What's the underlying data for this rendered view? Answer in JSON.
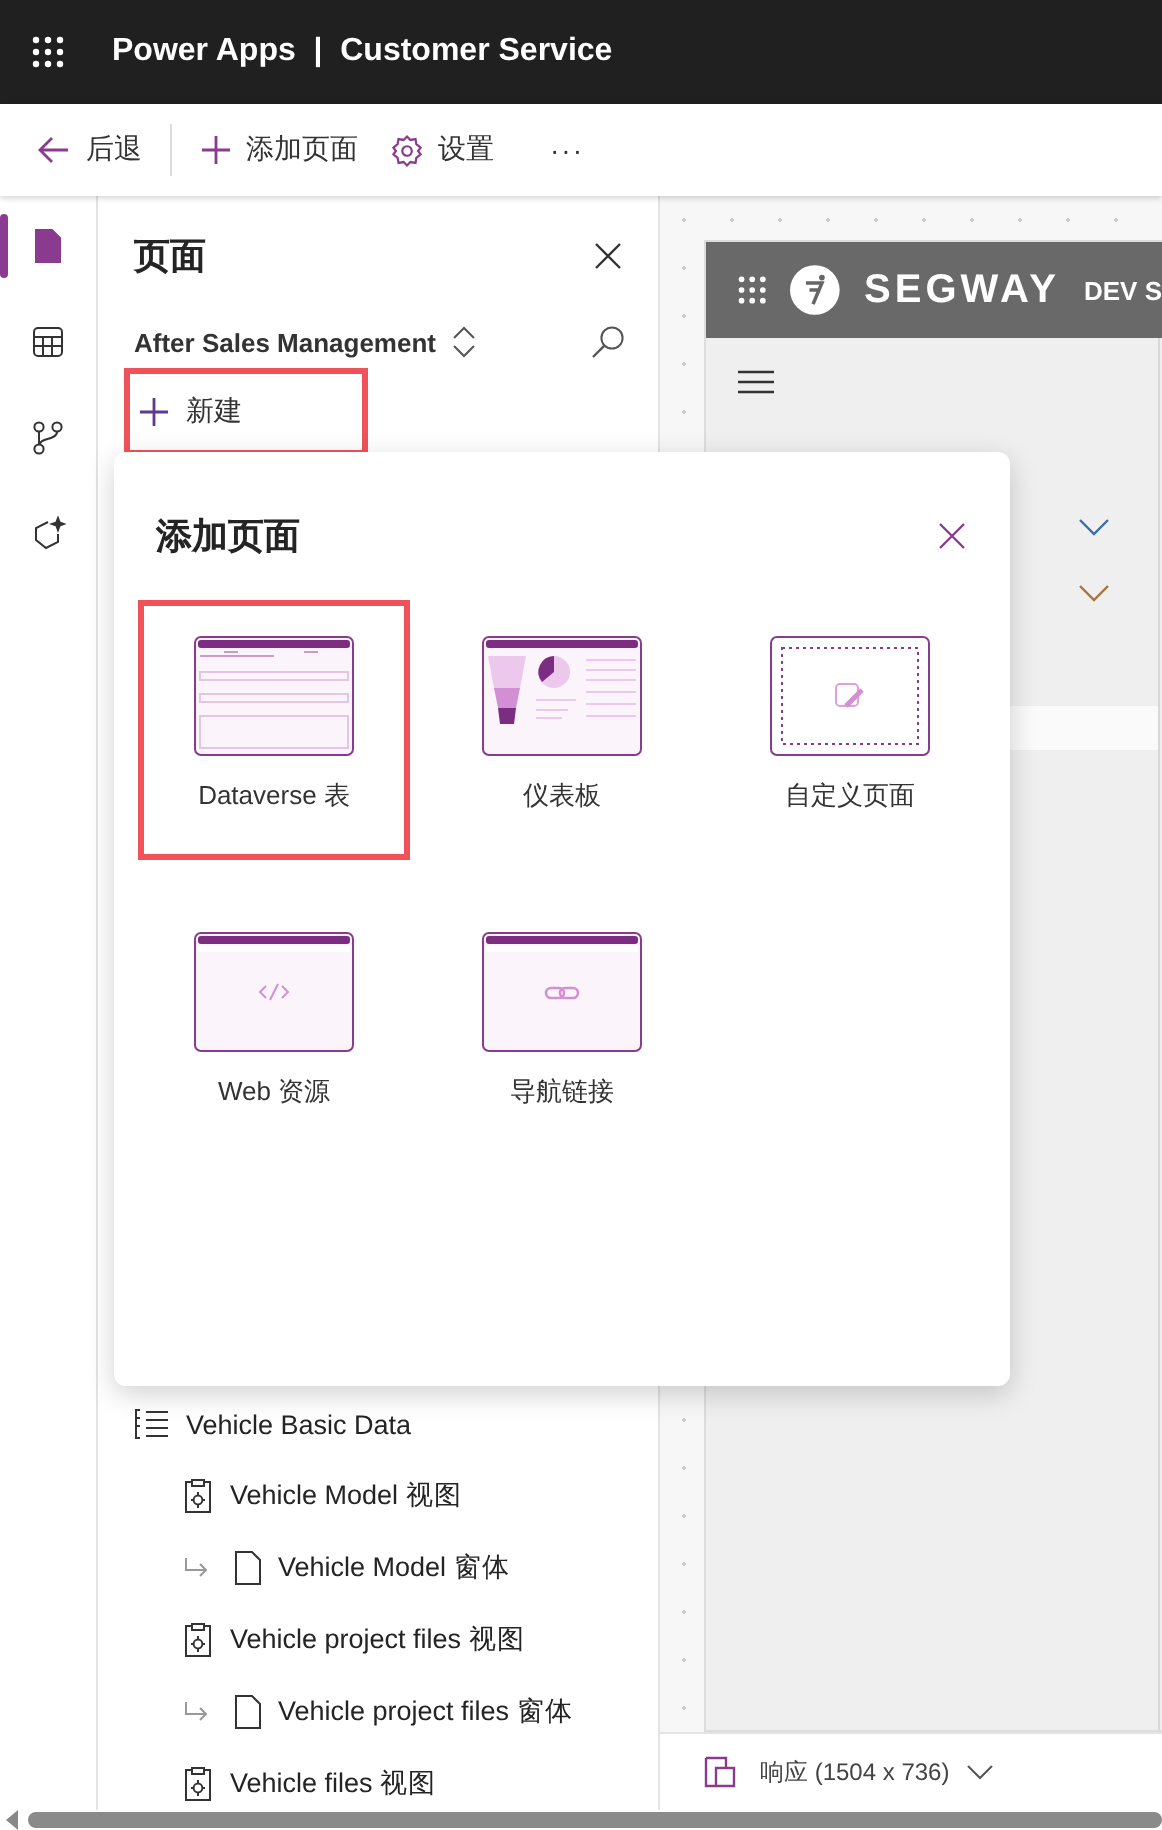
{
  "app_bar": {
    "title": "Power Apps  |  Customer Service"
  },
  "toolbar": [
    {
      "kind": "back",
      "label": "后退"
    },
    {
      "kind": "add",
      "label": "添加页面"
    },
    {
      "kind": "settings",
      "label": "设置"
    },
    {
      "kind": "more",
      "label": "···"
    }
  ],
  "rail": [
    {
      "kind": "pages",
      "selected": true
    },
    {
      "kind": "tables",
      "selected": false
    },
    {
      "kind": "flows",
      "selected": false
    },
    {
      "kind": "copilot",
      "selected": false
    }
  ],
  "panel": {
    "title": "页面",
    "app_name": "After Sales Management",
    "new_button": {
      "label": "新建",
      "highlighted": true
    },
    "tree": [
      {
        "kind": "group",
        "label": "Vehicle Basic Data",
        "children": [
          {
            "kind": "view",
            "label": "Vehicle Model 视图",
            "children": [
              {
                "kind": "form",
                "label": "Vehicle Model 窗体"
              }
            ]
          },
          {
            "kind": "view",
            "label": "Vehicle project files 视图",
            "children": [
              {
                "kind": "form",
                "label": "Vehicle project files 窗体"
              }
            ]
          },
          {
            "kind": "view",
            "label": "Vehicle files 视图"
          }
        ]
      }
    ]
  },
  "dialog": {
    "title": "添加页面",
    "tiles": [
      {
        "kind": "table",
        "label": "Dataverse 表",
        "highlighted": true
      },
      {
        "kind": "dashboard",
        "label": "仪表板",
        "highlighted": false
      },
      {
        "kind": "custom",
        "label": "自定义页面",
        "highlighted": false
      },
      {
        "kind": "web",
        "label": "Web 资源",
        "highlighted": false
      },
      {
        "kind": "link",
        "label": "导航链接",
        "highlighted": false
      }
    ]
  },
  "preview": {
    "brand": "SEGWAY",
    "env": "DEV S"
  },
  "status": {
    "label": "响应 (1504 x 736)"
  }
}
